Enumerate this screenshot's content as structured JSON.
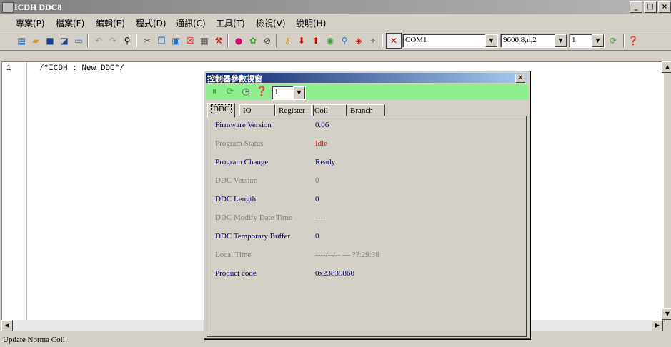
{
  "window": {
    "title": "ICDH DDC8",
    "buttons": [
      "_",
      "□",
      "×"
    ]
  },
  "menu": [
    "專案(P)",
    "檔案(F)",
    "編輯(E)",
    "程式(D)",
    "通訊(C)",
    "工具(T)",
    "檢視(V)",
    "說明(H)"
  ],
  "toolbar": {
    "port_value": "COM1",
    "baud_value": "9600,8,n,2",
    "station_value": "1"
  },
  "editor": {
    "line_number": "1",
    "code": "/*ICDH : New DDC*/"
  },
  "status": {
    "text": "Update Norma Coil"
  },
  "dialog": {
    "title": "控制器參數視窗",
    "station_value": "1",
    "tabs": [
      "DDC",
      "IO",
      "Register",
      "Coil",
      "Branch"
    ],
    "rows": [
      {
        "label": "Firmware Version",
        "value": "0.06",
        "label_color": "#000080",
        "value_color": "#000080"
      },
      {
        "label": "Program Status",
        "value": "Idle",
        "label_color": "#808080",
        "value_color": "#ff0000"
      },
      {
        "label": "Program Change",
        "value": "Ready",
        "label_color": "#000080",
        "value_color": "#000080"
      },
      {
        "label": "DDC Version",
        "value": "0",
        "label_color": "#808080",
        "value_color": "#808080"
      },
      {
        "label": "DDC Length",
        "value": "0",
        "label_color": "#000080",
        "value_color": "#000080"
      },
      {
        "label": "DDC Modify Date Time",
        "value": "----",
        "label_color": "#808080",
        "value_color": "#808080"
      },
      {
        "label": "DDC Temporary Buffer",
        "value": "0",
        "label_color": "#000080",
        "value_color": "#000080"
      },
      {
        "label": "Local Time",
        "value": "----/--/-- ---  ??:29:38",
        "label_color": "#808080",
        "value_color": "#808080"
      },
      {
        "label": "Product code",
        "value": "0x23835860",
        "label_color": "#000080",
        "value_color": "#000080"
      }
    ]
  }
}
